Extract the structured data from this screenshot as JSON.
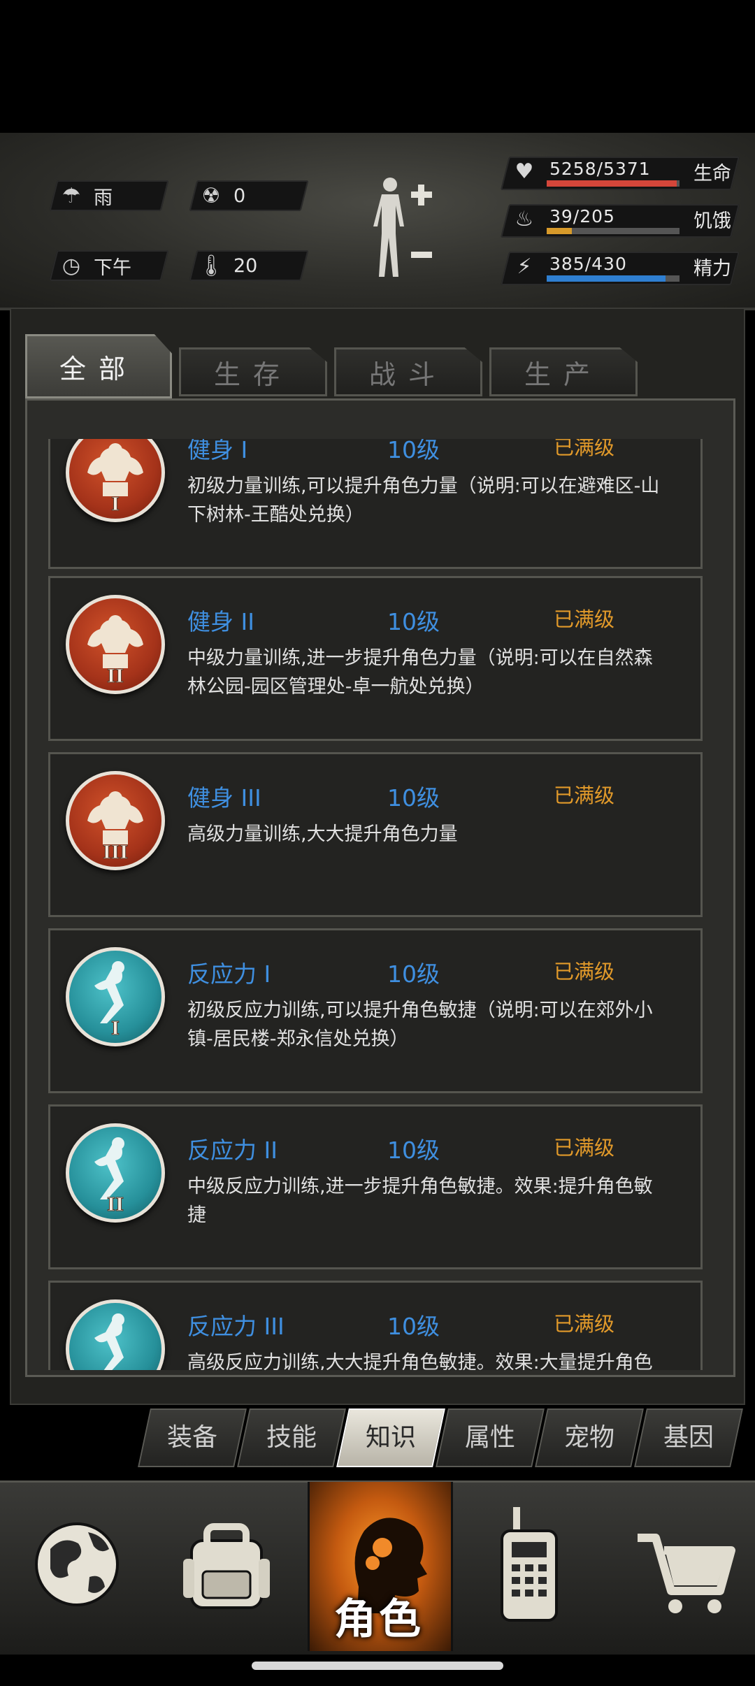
{
  "hud": {
    "weather": {
      "icon": "rain-cloud-icon",
      "label": "雨"
    },
    "radiation": {
      "icon": "radiation-icon",
      "value": "0"
    },
    "time": {
      "icon": "clock-icon",
      "label": "下午"
    },
    "temperature": {
      "icon": "thermometer-icon",
      "value": "20"
    },
    "stats": [
      {
        "icon": "heart-icon",
        "value": "5258/5371",
        "label": "生命",
        "fraction": 0.979,
        "color": "#d4463a"
      },
      {
        "icon": "stomach-icon",
        "value": "39/205",
        "label": "饥饿",
        "fraction": 0.19,
        "color": "#d79a2a"
      },
      {
        "icon": "energy-icon",
        "value": "385/430",
        "label": "精力",
        "fraction": 0.895,
        "color": "#2f7fd1"
      }
    ]
  },
  "tabs": [
    {
      "label": "全部",
      "active": true
    },
    {
      "label": "生存",
      "active": false
    },
    {
      "label": "战斗",
      "active": false
    },
    {
      "label": "生产",
      "active": false
    }
  ],
  "skills": [
    {
      "name": "健身 I",
      "level": "10级",
      "status": "已满级",
      "desc": "初级力量训练,可以提升角色力量（说明:可以在避难区-山下树林-王酷处兑换）",
      "badge": "red",
      "roman": "I",
      "kind": "muscle"
    },
    {
      "name": "健身 II",
      "level": "10级",
      "status": "已满级",
      "desc": "中级力量训练,进一步提升角色力量（说明:可以在自然森林公园-园区管理处-卓一航处兑换）",
      "badge": "red",
      "roman": "II",
      "kind": "muscle"
    },
    {
      "name": "健身 III",
      "level": "10级",
      "status": "已满级",
      "desc": "高级力量训练,大大提升角色力量",
      "badge": "red",
      "roman": "III",
      "kind": "muscle"
    },
    {
      "name": "反应力 I",
      "level": "10级",
      "status": "已满级",
      "desc": "初级反应力训练,可以提升角色敏捷（说明:可以在郊外小镇-居民楼-郑永信处兑换）",
      "badge": "teal",
      "roman": "I",
      "kind": "agility"
    },
    {
      "name": "反应力 II",
      "level": "10级",
      "status": "已满级",
      "desc": "中级反应力训练,进一步提升角色敏捷。效果:提升角色敏捷",
      "badge": "teal",
      "roman": "II",
      "kind": "agility"
    },
    {
      "name": "反应力 III",
      "level": "10级",
      "status": "已满级",
      "desc": "高级反应力训练,大大提升角色敏捷。效果:大量提升角色敏",
      "badge": "teal",
      "roman": "III",
      "kind": "agility"
    }
  ],
  "categories": [
    {
      "label": "装备",
      "active": false
    },
    {
      "label": "技能",
      "active": false
    },
    {
      "label": "知识",
      "active": true
    },
    {
      "label": "属性",
      "active": false
    },
    {
      "label": "宠物",
      "active": false
    },
    {
      "label": "基因",
      "active": false
    }
  ],
  "bottom_nav": {
    "items": [
      {
        "icon": "globe-icon",
        "active": false
      },
      {
        "icon": "backpack-icon",
        "active": false
      },
      {
        "icon": "character-head-icon",
        "label": "角色",
        "active": true
      },
      {
        "icon": "walkie-talkie-icon",
        "active": false
      },
      {
        "icon": "shopping-cart-icon",
        "active": false
      }
    ]
  }
}
